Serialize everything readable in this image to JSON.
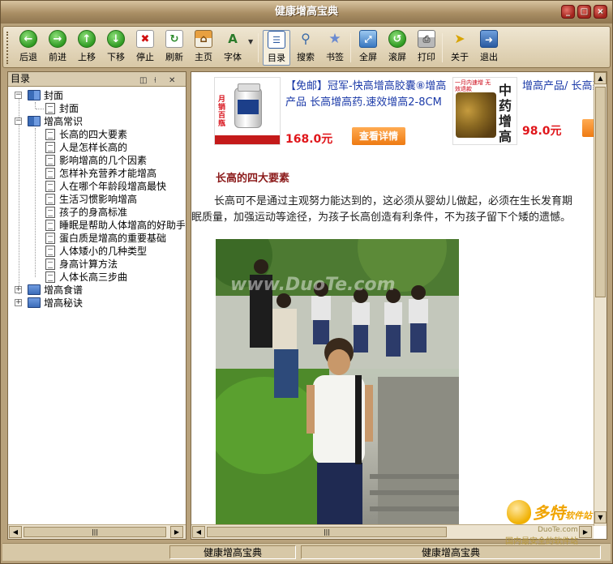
{
  "window": {
    "title": "健康增高宝典",
    "controls": [
      "_",
      "□",
      "×"
    ]
  },
  "toolbar": {
    "back": "后退",
    "forward": "前进",
    "up": "上移",
    "down": "下移",
    "stop": "停止",
    "refresh": "刷新",
    "home": "主页",
    "font": "字体",
    "toc": "目录",
    "search": "搜索",
    "bookmark": "书签",
    "fullscreen": "全屏",
    "scroll": "滚屏",
    "print": "打印",
    "about": "关于",
    "exit": "退出"
  },
  "sidebar": {
    "title": "目录",
    "tree": [
      {
        "label": "封面",
        "children": [
          "封面"
        ]
      },
      {
        "label": "增高常识",
        "children": [
          "长高的四大要素",
          "人是怎样长高的",
          "影响增高的几个因素",
          "怎样补充营养才能增高",
          "人在哪个年龄段增高最快",
          "生活习惯影响增高",
          "孩子的身高标准",
          "睡眠是帮助人体增高的好助手",
          "蛋白质是增高的重要基础",
          "人体矮小的几种类型",
          "身高计算方法",
          "人体长高三步曲"
        ]
      },
      {
        "label": "增高食谱",
        "children": []
      },
      {
        "label": "增高秘诀",
        "children": []
      }
    ]
  },
  "ads": [
    {
      "title": "【免邮】冠军-快高增高胶囊⑧增高产品 长高增高药.速效增高2-8CM",
      "price": "168.0元",
      "button": "查看详情",
      "badge": "月销百瓶"
    },
    {
      "title": "增高产品/ 长高药增高/增高药/",
      "price": "98.0元",
      "top_note": "一月内速增 无效退款",
      "badge": "中药增高"
    }
  ],
  "article": {
    "title": "长高的四大要素",
    "line1": "长高可不是通过主观努力能达到的，这必须从婴幼儿做起，必须在生长发育期",
    "line2": "眠质量，加强运动等途径，为孩子长高创造有利条件，不为孩子留下个矮的遗憾。",
    "watermark": "www.DuoTe.com"
  },
  "statusbar": {
    "left": "健康增高宝典",
    "right": "健康增高宝典"
  },
  "logo": {
    "brand": "多特",
    "brand_suffix": "软件站",
    "url": "DuoTe.com",
    "tagline": "国内最安全的软件站"
  }
}
